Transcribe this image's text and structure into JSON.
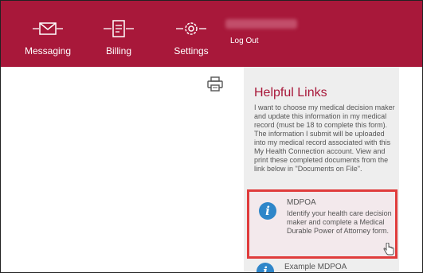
{
  "nav": {
    "items": [
      {
        "label": "Messaging",
        "icon": "envelope-icon"
      },
      {
        "label": "Billing",
        "icon": "bill-icon"
      },
      {
        "label": "Settings",
        "icon": "gear-icon"
      }
    ],
    "logout_label": "Log Out"
  },
  "colors": {
    "brand": "#a8183a",
    "info": "#2e86c9",
    "highlight": "#e03c3c",
    "panel": "#eeeeee"
  },
  "helpful_links": {
    "title": "Helpful Links",
    "description": "I want to choose my medical decision maker and update this information in my medical record (must be 18 to complete this form). The information I submit will be uploaded into my medical record associated with this My Health Connection account. View and print these completed documents from the link below in \"Documents on File\".",
    "links": [
      {
        "title": "MDPOA",
        "description": "Identify your health care decision maker and complete a Medical Durable Power of Attorney form.",
        "icon": "info-icon"
      },
      {
        "title": "Example MDPOA",
        "icon": "info-icon"
      }
    ]
  }
}
